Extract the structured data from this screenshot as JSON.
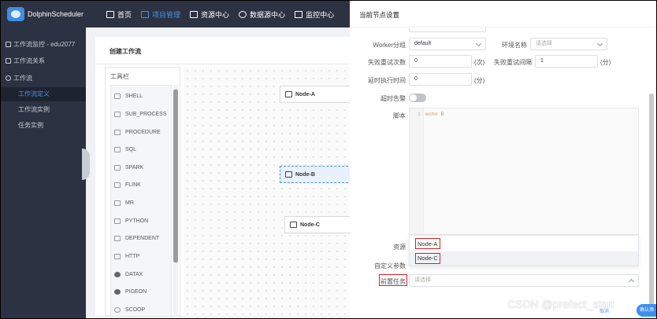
{
  "app": {
    "name": "DolphinScheduler"
  },
  "nav": [
    {
      "label": "首页",
      "icon": "home-icon"
    },
    {
      "label": "项目管理",
      "icon": "project-icon",
      "active": true
    },
    {
      "label": "资源中心",
      "icon": "folder-icon"
    },
    {
      "label": "数据源中心",
      "icon": "database-icon"
    },
    {
      "label": "监控中心",
      "icon": "monitor-icon"
    }
  ],
  "sidebar": {
    "project": "工作流监控 - edu2077",
    "relation": "工作流关系",
    "workflow": "工作流",
    "items": [
      "工作流定义",
      "工作流实例",
      "任务实例"
    ]
  },
  "main": {
    "title": "创建工作流",
    "toolbox_title": "工具栏",
    "tasks": [
      "SHELL",
      "SUB_PROCESS",
      "PROCEDURE",
      "SQL",
      "SPARK",
      "FLINK",
      "MR",
      "PYTHON",
      "DEPENDENT",
      "HTTP",
      "DATAX",
      "PIGEON",
      "SCOOP"
    ],
    "nodes": [
      "Node-A",
      "Node-B",
      "Node-C"
    ]
  },
  "drawer": {
    "title": "当前节点设置",
    "worker_label": "Worker分组",
    "worker_value": "default",
    "env_label": "环境名称",
    "env_placeholder": "请选择",
    "retry_times_label": "失败重试次数",
    "retry_times_value": "0",
    "retry_times_unit": "(次)",
    "retry_interval_label": "失败重试间隔",
    "retry_interval_value": "1",
    "retry_interval_unit": "(分)",
    "delay_label": "延时执行时间",
    "delay_value": "0",
    "delay_unit": "(分)",
    "timeout_label": "超时告警",
    "timeout_on": false,
    "script_label": "脚本",
    "script_line": "1",
    "script_code": "echo B",
    "resource_label": "资源",
    "custom_param_label": "自定义参数",
    "pre_task_label": "前置任务",
    "pre_task_placeholder": "请选择",
    "dropdown_options": [
      "Node-A",
      "Node-C"
    ],
    "cancel": "取消",
    "confirm": "确认添加"
  },
  "watermark": "CSDN @prefect_start",
  "colors": {
    "nav_bg": "#2c3241",
    "accent": "#4a90e2",
    "highlight": "#e02020"
  }
}
